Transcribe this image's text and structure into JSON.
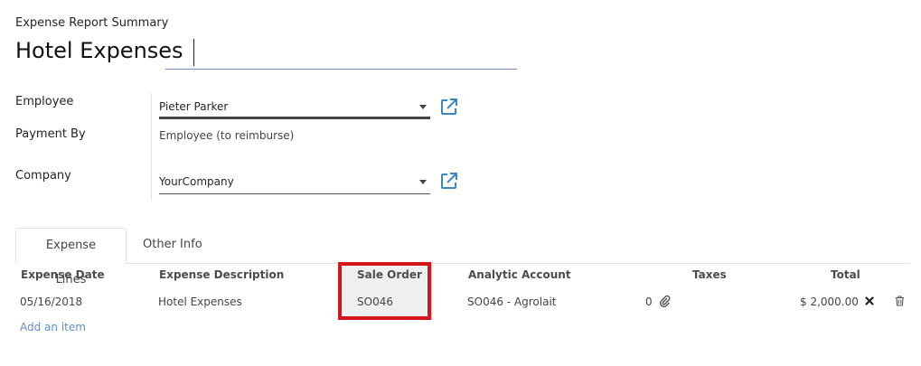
{
  "header": {
    "summary_label": "Expense Report Summary",
    "title": "Hotel Expenses"
  },
  "form": {
    "employee_label": "Employee",
    "employee_value": "Pieter Parker",
    "payment_label": "Payment By",
    "payment_value": "Employee (to reimburse)",
    "company_label": "Company",
    "company_value": "YourCompany"
  },
  "tabs": [
    {
      "label": "Expense Lines",
      "active": true
    },
    {
      "label": "Other Info",
      "active": false
    }
  ],
  "table": {
    "columns": [
      "Expense Date",
      "Expense Description",
      "Sale Order",
      "Analytic Account",
      "Taxes",
      "Total"
    ],
    "rows": [
      {
        "date": "05/16/2018",
        "description": "Hotel Expenses",
        "sale_order": "SO046",
        "analytic_account": "SO046 - Agrolait",
        "attachments": "0",
        "taxes": "",
        "total": "$ 2,000.00"
      }
    ],
    "add_item_label": "Add an item"
  },
  "colors": {
    "accent_link": "#5d8ecb",
    "highlight_border": "#d6141b",
    "ext_link_icon": "#3a87c8"
  },
  "icons": {
    "ext_link": "external-link-icon",
    "dropdown": "caret-down-icon",
    "attachment": "paperclip-icon",
    "remove": "close-icon",
    "trash": "trash-icon"
  }
}
